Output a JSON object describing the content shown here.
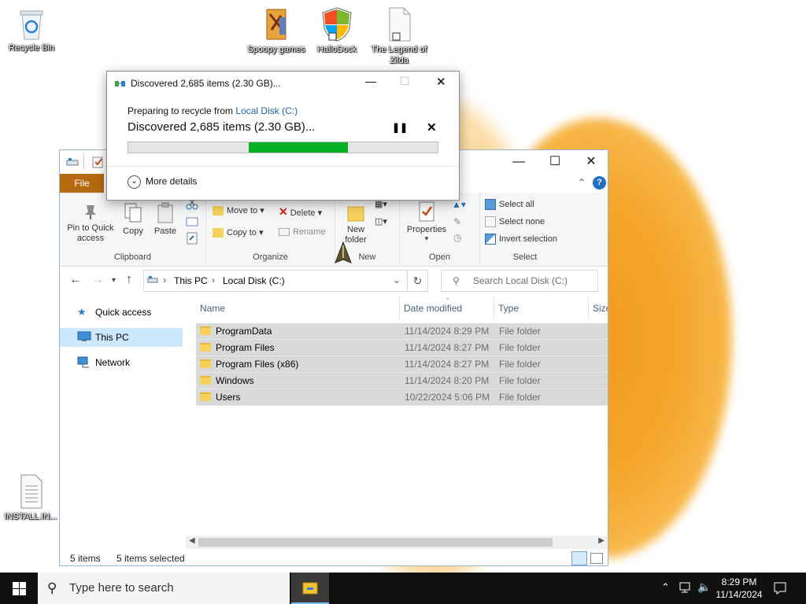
{
  "desktop": {
    "icons": [
      {
        "label": "Recycle Bin",
        "icon": "recycle-bin-icon"
      },
      {
        "label": "Spoopy games",
        "icon": "folder-icon"
      },
      {
        "label": "HalloDock",
        "icon": "shield-icon"
      },
      {
        "label": "The Legend of Zilda",
        "icon": "document-icon"
      },
      {
        "label": "INSTALL.IN...",
        "icon": "text-file-icon"
      }
    ]
  },
  "dialog": {
    "title": "Discovered 2,685 items (2.30 GB)...",
    "line1_prefix": "Preparing to recycle from ",
    "line1_link": "Local Disk (C:)",
    "line2": "Discovered 2,685 items (2.30 GB)...",
    "progress_fill_start": 0.39,
    "progress_fill_end": 0.71,
    "progress_color": "#06b025",
    "more_details": "More details"
  },
  "explorer": {
    "file_tab": "File",
    "ribbon": {
      "clipboard": {
        "group": "Clipboard",
        "pin": "Pin to Quick access",
        "copy": "Copy",
        "paste": "Paste"
      },
      "organize": {
        "group": "Organize",
        "move_to": "Move to",
        "copy_to": "Copy to",
        "delete": "Delete",
        "rename": "Rename"
      },
      "new": {
        "group": "New",
        "new_folder": "New folder"
      },
      "open": {
        "group": "Open",
        "properties": "Properties"
      },
      "select": {
        "group": "Select",
        "select_all": "Select all",
        "select_none": "Select none",
        "invert": "Invert selection"
      }
    },
    "address": {
      "crumbs": [
        "This PC",
        "Local Disk (C:)"
      ],
      "search_placeholder": "Search Local Disk (C:)"
    },
    "nav": [
      {
        "label": "Quick access",
        "icon": "star-icon"
      },
      {
        "label": "This PC",
        "icon": "computer-icon"
      },
      {
        "label": "Network",
        "icon": "network-icon"
      }
    ],
    "columns": [
      "Name",
      "Date modified",
      "Type",
      "Size"
    ],
    "rows": [
      {
        "name": "ProgramData",
        "date": "11/14/2024 8:29 PM",
        "type": "File folder"
      },
      {
        "name": "Program Files",
        "date": "11/14/2024 8:27 PM",
        "type": "File folder"
      },
      {
        "name": "Program Files (x86)",
        "date": "11/14/2024 8:27 PM",
        "type": "File folder"
      },
      {
        "name": "Windows",
        "date": "11/14/2024 8:20 PM",
        "type": "File folder"
      },
      {
        "name": "Users",
        "date": "10/22/2024 5:06 PM",
        "type": "File folder"
      }
    ],
    "status": {
      "count": "5 items",
      "selected": "5 items selected"
    }
  },
  "taskbar": {
    "search_placeholder": "Type here to search",
    "time": "8:29 PM",
    "date": "11/14/2024"
  }
}
